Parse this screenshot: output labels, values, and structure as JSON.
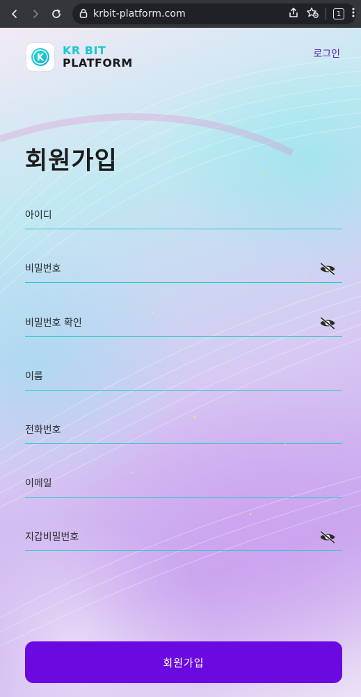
{
  "browser": {
    "url": "krbit-platform.com",
    "tab_count": "1"
  },
  "header": {
    "brand_line1": "KR BIT",
    "brand_line2": "PLATFORM",
    "login_link": "로그인",
    "logo_letter": "K"
  },
  "form": {
    "title": "회원가입",
    "fields": [
      {
        "placeholder": "아이디",
        "type": "text",
        "has_eye": false
      },
      {
        "placeholder": "비밀번호",
        "type": "password",
        "has_eye": true
      },
      {
        "placeholder": "비밀번호 확인",
        "type": "password",
        "has_eye": true
      },
      {
        "placeholder": "이름",
        "type": "text",
        "has_eye": false
      },
      {
        "placeholder": "전화번호",
        "type": "text",
        "has_eye": false
      },
      {
        "placeholder": "이메일",
        "type": "text",
        "has_eye": false
      },
      {
        "placeholder": "지갑비밀번호",
        "type": "password",
        "has_eye": true
      }
    ],
    "submit_label": "회원가입"
  },
  "colors": {
    "accent": "#6b0ae0",
    "brand_cyan": "#14c8d4",
    "underline": "#2bc7c8",
    "login_link": "#5b21b6"
  },
  "icons": [
    "back-icon",
    "forward-icon",
    "reload-icon",
    "lock-icon",
    "share-icon",
    "bookmark-star-icon",
    "tab-count-icon",
    "menu-icon",
    "eye-slash-icon"
  ]
}
